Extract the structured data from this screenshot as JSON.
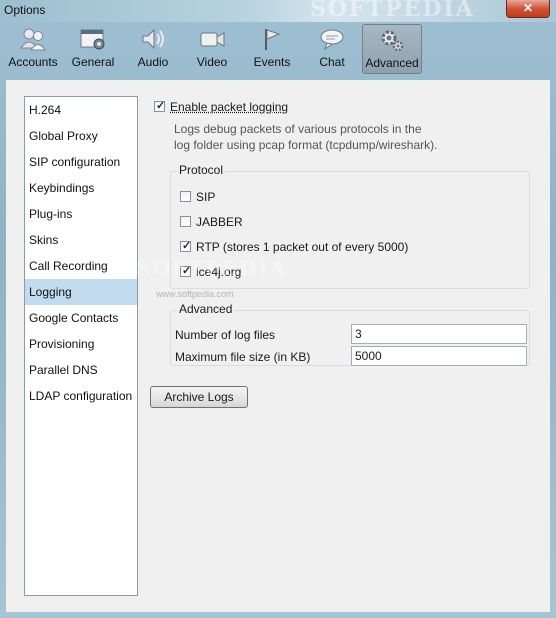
{
  "window": {
    "title": "Options",
    "close_label": "✕"
  },
  "toolbar": {
    "tabs": [
      {
        "label": "Accounts",
        "icon": "accounts-icon"
      },
      {
        "label": "General",
        "icon": "general-icon"
      },
      {
        "label": "Audio",
        "icon": "audio-icon"
      },
      {
        "label": "Video",
        "icon": "video-icon"
      },
      {
        "label": "Events",
        "icon": "events-icon"
      },
      {
        "label": "Chat",
        "icon": "chat-icon"
      },
      {
        "label": "Advanced",
        "icon": "advanced-icon",
        "active": true
      }
    ]
  },
  "sidebar": {
    "items": [
      {
        "label": "H.264"
      },
      {
        "label": "Global Proxy"
      },
      {
        "label": "SIP configuration"
      },
      {
        "label": "Keybindings"
      },
      {
        "label": "Plug-ins"
      },
      {
        "label": "Skins"
      },
      {
        "label": "Call Recording"
      },
      {
        "label": "Logging",
        "selected": true
      },
      {
        "label": "Google Contacts"
      },
      {
        "label": "Provisioning"
      },
      {
        "label": "Parallel DNS"
      },
      {
        "label": "LDAP configuration"
      }
    ]
  },
  "logging": {
    "enable_label": "Enable packet logging",
    "enable_checked": true,
    "description_line1": "Logs debug packets of various protocols in the",
    "description_line2": "log folder using pcap format (tcpdump/wireshark).",
    "protocol": {
      "title": "Protocol",
      "items": [
        {
          "label": "SIP",
          "checked": false
        },
        {
          "label": "JABBER",
          "checked": false
        },
        {
          "label": "RTP (stores 1 packet out of every 5000)",
          "checked": true
        },
        {
          "label": "ice4j.org",
          "checked": true
        }
      ]
    },
    "advanced": {
      "title": "Advanced",
      "log_files_label": "Number of log files",
      "log_files_value": "3",
      "max_size_label": "Maximum file size (in KB)",
      "max_size_value": "5000"
    },
    "archive_button": "Archive Logs"
  },
  "watermark": {
    "top": "SOFTPEDIA",
    "center": "SOFTPEDIA",
    "url": "www.softpedia.com"
  },
  "colors": {
    "accent_selection": "#c2dcef",
    "close_red": "#c13a1c"
  }
}
